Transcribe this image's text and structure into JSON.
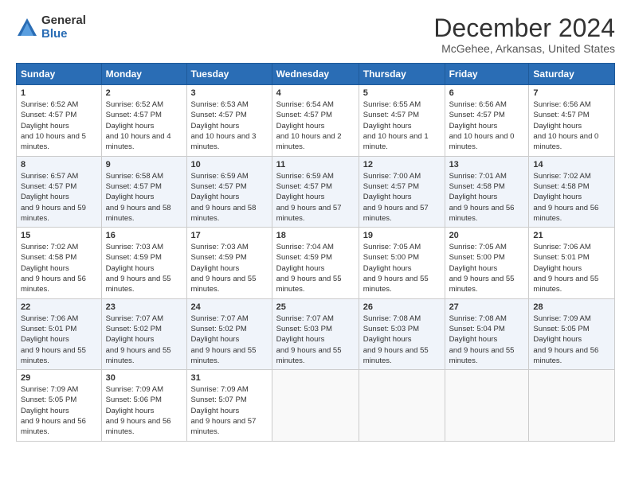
{
  "logo": {
    "general": "General",
    "blue": "Blue"
  },
  "title": "December 2024",
  "subtitle": "McGehee, Arkansas, United States",
  "days": [
    "Sunday",
    "Monday",
    "Tuesday",
    "Wednesday",
    "Thursday",
    "Friday",
    "Saturday"
  ],
  "weeks": [
    [
      {
        "day": "1",
        "sunrise": "6:52 AM",
        "sunset": "4:57 PM",
        "daylight": "10 hours and 5 minutes."
      },
      {
        "day": "2",
        "sunrise": "6:52 AM",
        "sunset": "4:57 PM",
        "daylight": "10 hours and 4 minutes."
      },
      {
        "day": "3",
        "sunrise": "6:53 AM",
        "sunset": "4:57 PM",
        "daylight": "10 hours and 3 minutes."
      },
      {
        "day": "4",
        "sunrise": "6:54 AM",
        "sunset": "4:57 PM",
        "daylight": "10 hours and 2 minutes."
      },
      {
        "day": "5",
        "sunrise": "6:55 AM",
        "sunset": "4:57 PM",
        "daylight": "10 hours and 1 minute."
      },
      {
        "day": "6",
        "sunrise": "6:56 AM",
        "sunset": "4:57 PM",
        "daylight": "10 hours and 0 minutes."
      },
      {
        "day": "7",
        "sunrise": "6:56 AM",
        "sunset": "4:57 PM",
        "daylight": "10 hours and 0 minutes."
      }
    ],
    [
      {
        "day": "8",
        "sunrise": "6:57 AM",
        "sunset": "4:57 PM",
        "daylight": "9 hours and 59 minutes."
      },
      {
        "day": "9",
        "sunrise": "6:58 AM",
        "sunset": "4:57 PM",
        "daylight": "9 hours and 58 minutes."
      },
      {
        "day": "10",
        "sunrise": "6:59 AM",
        "sunset": "4:57 PM",
        "daylight": "9 hours and 58 minutes."
      },
      {
        "day": "11",
        "sunrise": "6:59 AM",
        "sunset": "4:57 PM",
        "daylight": "9 hours and 57 minutes."
      },
      {
        "day": "12",
        "sunrise": "7:00 AM",
        "sunset": "4:57 PM",
        "daylight": "9 hours and 57 minutes."
      },
      {
        "day": "13",
        "sunrise": "7:01 AM",
        "sunset": "4:58 PM",
        "daylight": "9 hours and 56 minutes."
      },
      {
        "day": "14",
        "sunrise": "7:02 AM",
        "sunset": "4:58 PM",
        "daylight": "9 hours and 56 minutes."
      }
    ],
    [
      {
        "day": "15",
        "sunrise": "7:02 AM",
        "sunset": "4:58 PM",
        "daylight": "9 hours and 56 minutes."
      },
      {
        "day": "16",
        "sunrise": "7:03 AM",
        "sunset": "4:59 PM",
        "daylight": "9 hours and 55 minutes."
      },
      {
        "day": "17",
        "sunrise": "7:03 AM",
        "sunset": "4:59 PM",
        "daylight": "9 hours and 55 minutes."
      },
      {
        "day": "18",
        "sunrise": "7:04 AM",
        "sunset": "4:59 PM",
        "daylight": "9 hours and 55 minutes."
      },
      {
        "day": "19",
        "sunrise": "7:05 AM",
        "sunset": "5:00 PM",
        "daylight": "9 hours and 55 minutes."
      },
      {
        "day": "20",
        "sunrise": "7:05 AM",
        "sunset": "5:00 PM",
        "daylight": "9 hours and 55 minutes."
      },
      {
        "day": "21",
        "sunrise": "7:06 AM",
        "sunset": "5:01 PM",
        "daylight": "9 hours and 55 minutes."
      }
    ],
    [
      {
        "day": "22",
        "sunrise": "7:06 AM",
        "sunset": "5:01 PM",
        "daylight": "9 hours and 55 minutes."
      },
      {
        "day": "23",
        "sunrise": "7:07 AM",
        "sunset": "5:02 PM",
        "daylight": "9 hours and 55 minutes."
      },
      {
        "day": "24",
        "sunrise": "7:07 AM",
        "sunset": "5:02 PM",
        "daylight": "9 hours and 55 minutes."
      },
      {
        "day": "25",
        "sunrise": "7:07 AM",
        "sunset": "5:03 PM",
        "daylight": "9 hours and 55 minutes."
      },
      {
        "day": "26",
        "sunrise": "7:08 AM",
        "sunset": "5:03 PM",
        "daylight": "9 hours and 55 minutes."
      },
      {
        "day": "27",
        "sunrise": "7:08 AM",
        "sunset": "5:04 PM",
        "daylight": "9 hours and 55 minutes."
      },
      {
        "day": "28",
        "sunrise": "7:09 AM",
        "sunset": "5:05 PM",
        "daylight": "9 hours and 56 minutes."
      }
    ],
    [
      {
        "day": "29",
        "sunrise": "7:09 AM",
        "sunset": "5:05 PM",
        "daylight": "9 hours and 56 minutes."
      },
      {
        "day": "30",
        "sunrise": "7:09 AM",
        "sunset": "5:06 PM",
        "daylight": "9 hours and 56 minutes."
      },
      {
        "day": "31",
        "sunrise": "7:09 AM",
        "sunset": "5:07 PM",
        "daylight": "9 hours and 57 minutes."
      },
      null,
      null,
      null,
      null
    ]
  ],
  "labels": {
    "sunrise": "Sunrise: ",
    "sunset": "Sunset: ",
    "daylight": "Daylight hours"
  }
}
